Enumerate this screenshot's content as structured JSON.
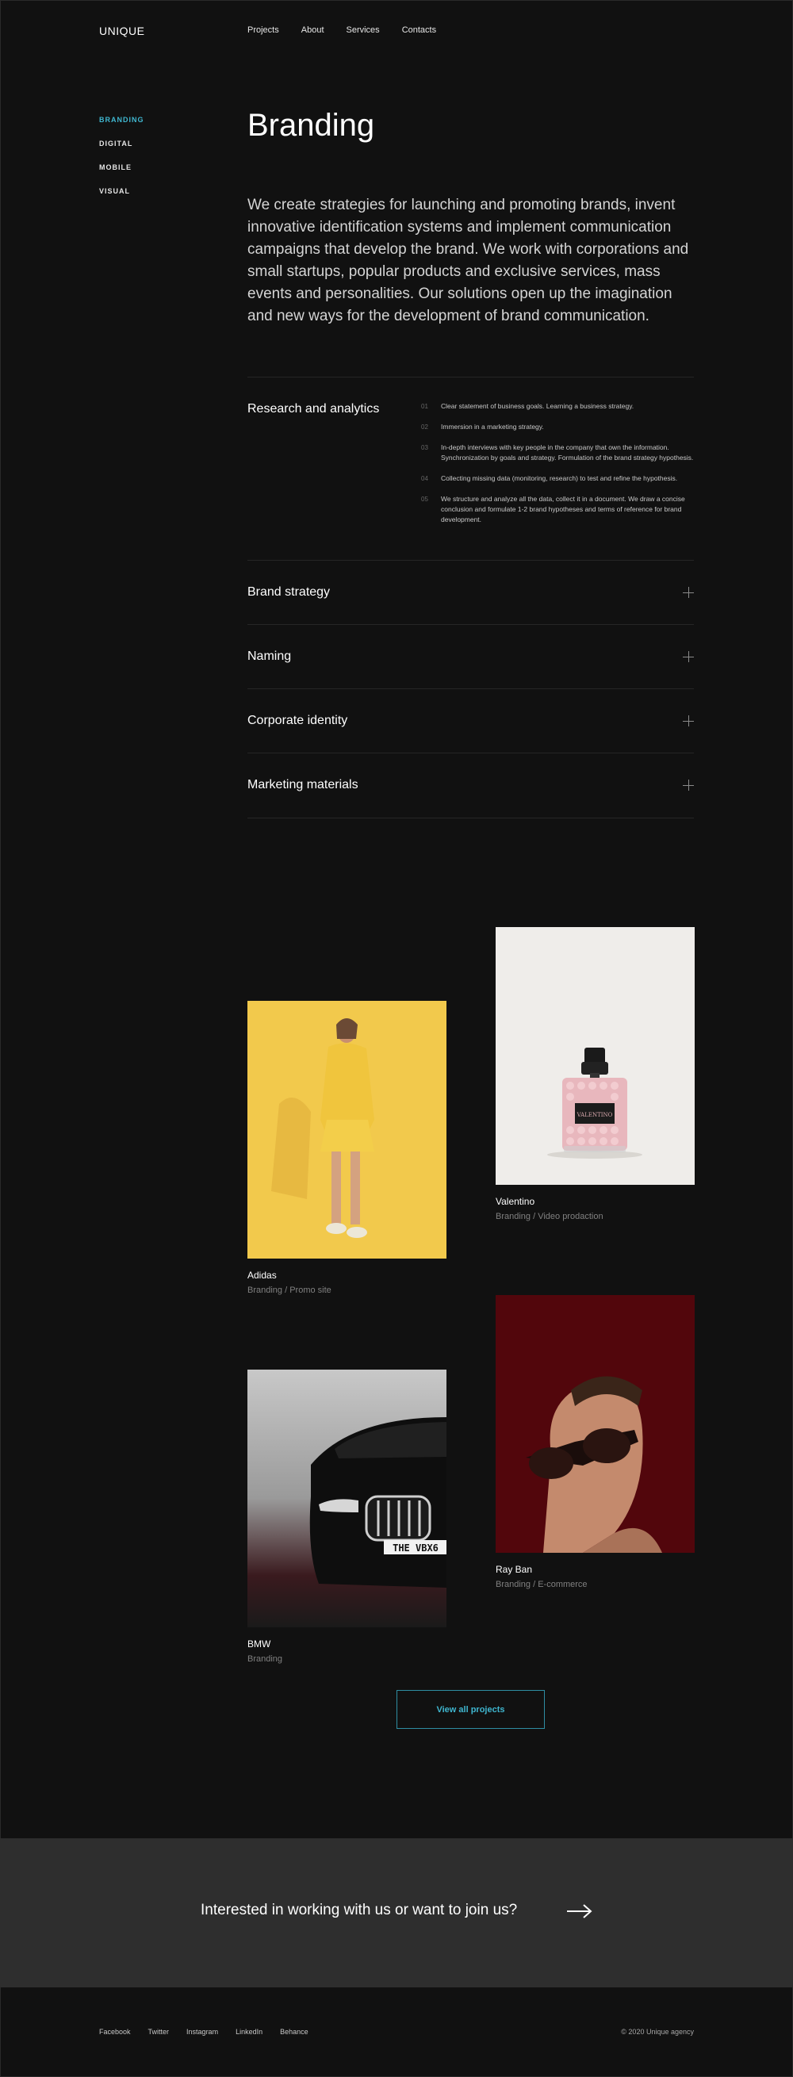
{
  "header": {
    "logo": "UNIQUE",
    "nav": [
      "Projects",
      "About",
      "Services",
      "Contacts"
    ]
  },
  "sidebar": {
    "items": [
      {
        "label": "BRANDING",
        "active": true
      },
      {
        "label": "DIGITAL",
        "active": false
      },
      {
        "label": "MOBILE",
        "active": false
      },
      {
        "label": "VISUAL",
        "active": false
      }
    ]
  },
  "page": {
    "title": "Branding",
    "lead": "We create strategies for launching and promoting brands, invent innovative identification systems and implement communication campaigns that develop the brand. We work with corporations and small startups, popular products and exclusive services, mass events and personalities. Our solutions open up the imagination and new ways for the development of brand communication."
  },
  "accordion": {
    "open": {
      "title": "Research and analytics",
      "steps": [
        {
          "num": "01",
          "text": "Clear statement of business goals. Learning a business strategy."
        },
        {
          "num": "02",
          "text": "Immersion in a marketing strategy."
        },
        {
          "num": "03",
          "text": "In-depth interviews with key people in the company that own the information. Synchronization by goals and strategy. Formulation of the brand strategy hypothesis."
        },
        {
          "num": "04",
          "text": "Collecting missing data (monitoring, research) to test and refine the hypothesis."
        },
        {
          "num": "05",
          "text": "We structure and analyze all the data, collect it in a document. We draw a concise conclusion and formulate 1-2 brand hypotheses and terms of reference for brand development."
        }
      ]
    },
    "closed": [
      "Brand strategy",
      "Naming",
      "Corporate identity",
      "Marketing materials"
    ]
  },
  "projects": [
    {
      "name": "Valentino",
      "tags": "Branding / Video prodaction",
      "image": "perfume-bottle"
    },
    {
      "name": "Adidas",
      "tags": "Branding / Promo site",
      "image": "woman-yellow"
    },
    {
      "name": "Ray Ban",
      "tags": "Branding / E-commerce",
      "image": "man-sunglasses"
    },
    {
      "name": "BMW",
      "tags": "Branding",
      "image": "black-car"
    }
  ],
  "bottle_label": "VALENTINO",
  "plate_text": "THE VBX6",
  "view_all": "View all projects",
  "cta": {
    "text": "Interested in working with us or want to join us?"
  },
  "footer": {
    "links": [
      "Facebook",
      "Twitter",
      "Instagram",
      "LinkedIn",
      "Behance"
    ],
    "copyright": "© 2020 Unique agency"
  },
  "colors": {
    "accent": "#3fb6cf",
    "background": "#111111",
    "cta_bg": "#2e2e2e"
  }
}
